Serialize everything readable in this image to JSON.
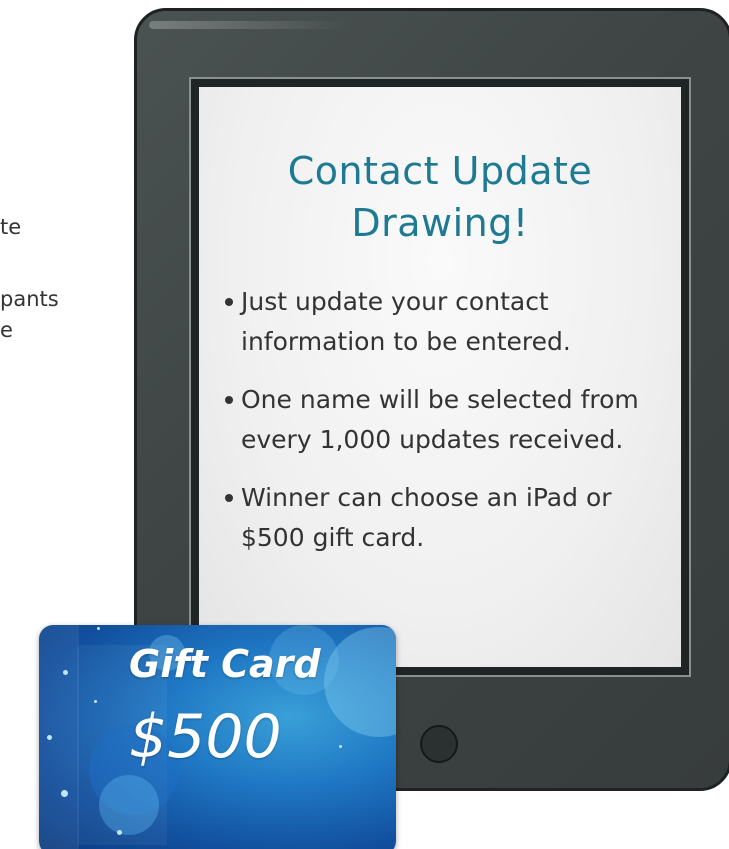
{
  "left_fragments": [
    "te",
    "pants",
    "e"
  ],
  "tablet": {
    "title_lines": [
      "Contact Update",
      "Drawing!"
    ],
    "bullets": [
      "Just update your contact information to be entered.",
      "One name will be selected from every 1,000 updates received.",
      "Winner can choose an iPad or $500 gift card."
    ]
  },
  "gift_card": {
    "title": "Gift Card",
    "amount": "$500"
  },
  "colors": {
    "title": "#1e7a93",
    "tablet_body": "#3f4545",
    "card_blue": "#1f78c4"
  }
}
